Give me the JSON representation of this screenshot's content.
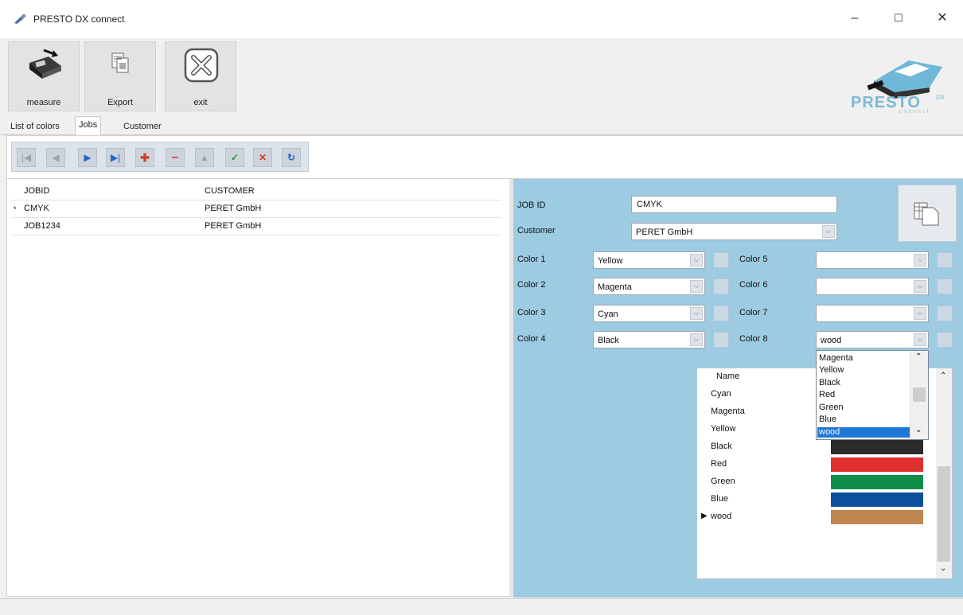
{
  "window": {
    "title": "PRESTO DX connect",
    "controls": {
      "minimize": "–",
      "maximize": "☐",
      "close": "✕"
    }
  },
  "toolbar": {
    "buttons": [
      {
        "label": "measure",
        "icon": "device-measure-icon"
      },
      {
        "label": "Export",
        "icon": "export-icon"
      },
      {
        "label": "exit",
        "icon": "exit-x-icon"
      }
    ],
    "logo_text": "PRESTO",
    "logo_superscript": "DX",
    "logo_subtext": "connect"
  },
  "tabs": [
    {
      "label": "List of colors",
      "active": false
    },
    {
      "label": "Jobs",
      "active": true
    },
    {
      "label": "Customer",
      "active": false
    }
  ],
  "navigator": {
    "buttons": [
      "first-record-icon",
      "prior-record-icon",
      "next-record-icon",
      "last-record-icon",
      "insert-record-icon",
      "delete-record-icon",
      "edit-record-icon",
      "post-record-icon",
      "cancel-record-icon",
      "refresh-record-icon"
    ]
  },
  "grid": {
    "columns": [
      "JOBID",
      "CUSTOMER"
    ],
    "rows": [
      {
        "indicator": "*",
        "jobid": "CMYK",
        "customer": "PERET GmbH"
      },
      {
        "indicator": "",
        "jobid": "JOB1234",
        "customer": "PERET GmbH"
      }
    ]
  },
  "detail": {
    "job_id_label": "JOB ID",
    "job_id_value": "CMYK",
    "customer_label": "Customer",
    "customer_value": "PERET GmbH",
    "colors_left": [
      {
        "label": "Color 1",
        "value": "Yellow"
      },
      {
        "label": "Color 2",
        "value": "Magenta"
      },
      {
        "label": "Color 3",
        "value": "Cyan"
      },
      {
        "label": "Color 4",
        "value": "Black"
      }
    ],
    "colors_right": [
      {
        "label": "Color 5",
        "value": ""
      },
      {
        "label": "Color 6",
        "value": ""
      },
      {
        "label": "Color 7",
        "value": ""
      },
      {
        "label": "Color 8",
        "value": "wood"
      }
    ]
  },
  "dropdown": {
    "options": [
      "Magenta",
      "Yellow",
      "Black",
      "Red",
      "Green",
      "Blue",
      "wood"
    ],
    "selected": "wood"
  },
  "color_table": {
    "header": "Name",
    "rows": [
      {
        "name": "Cyan",
        "color": ""
      },
      {
        "name": "Magenta",
        "color": ""
      },
      {
        "name": "Yellow",
        "color": ""
      },
      {
        "name": "Black",
        "color": "#2b2b2b"
      },
      {
        "name": "Red",
        "color": "#e0302f"
      },
      {
        "name": "Green",
        "color": "#0f8e4a"
      },
      {
        "name": "Blue",
        "color": "#0b4f9e"
      },
      {
        "name": "wood",
        "color": "#c0864f"
      }
    ],
    "current_row": "wood"
  }
}
